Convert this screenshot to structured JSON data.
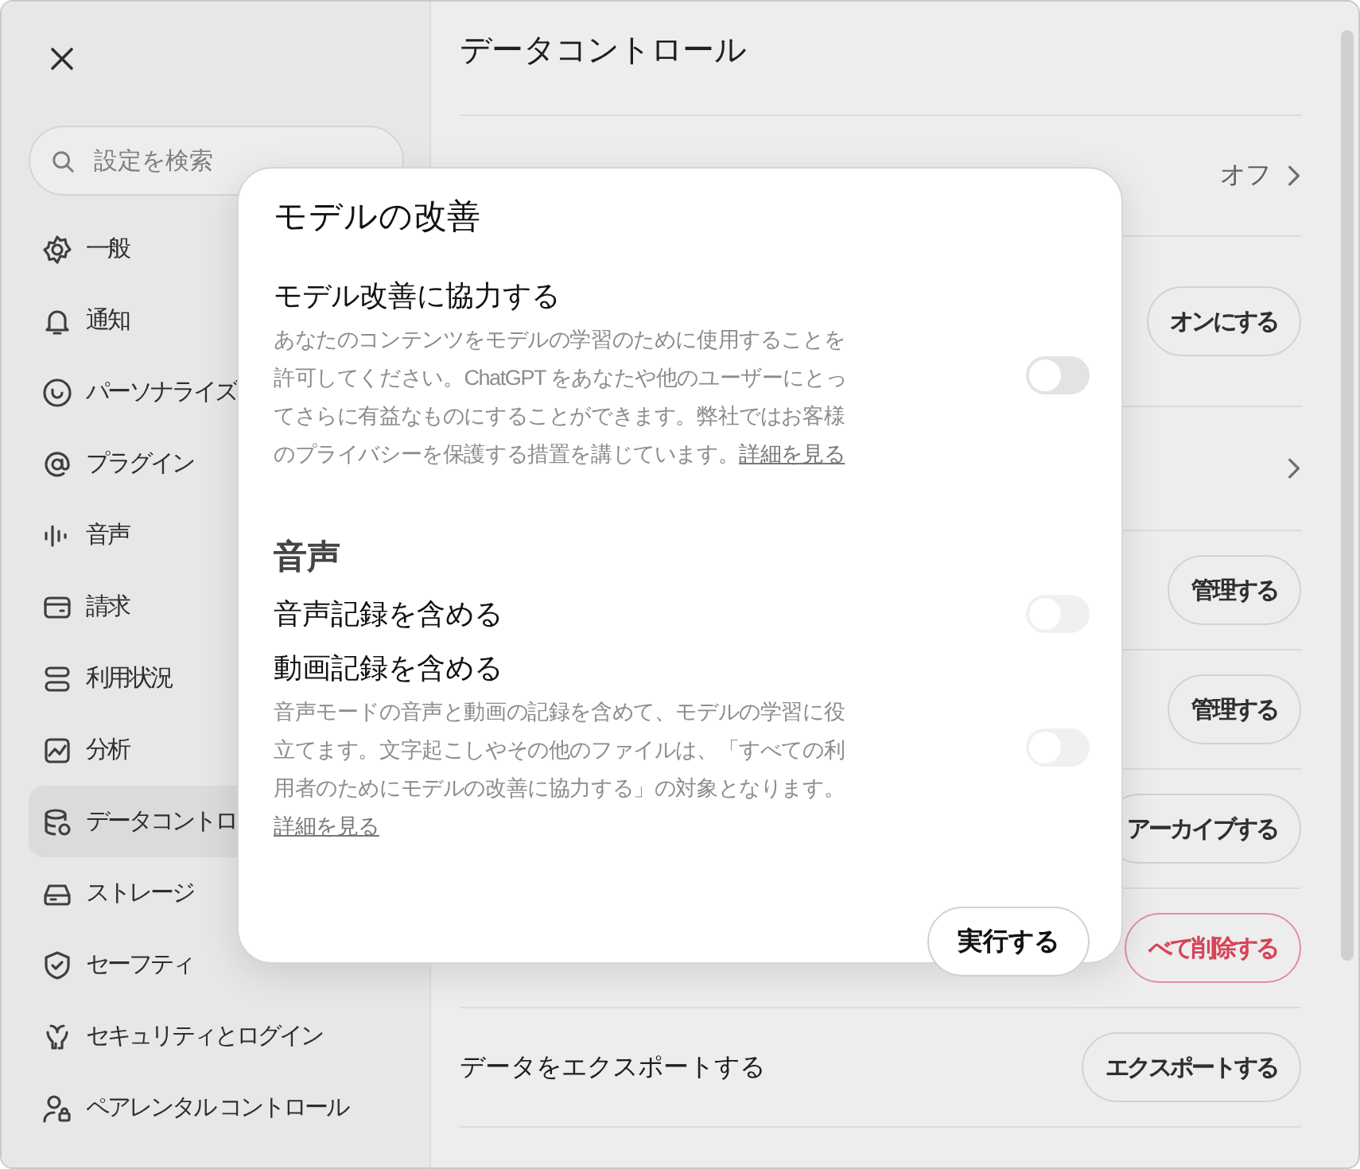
{
  "sidebar": {
    "search": {
      "placeholder": "設定を検索"
    },
    "items": [
      {
        "label": "一般",
        "selected": false
      },
      {
        "label": "通知",
        "selected": false
      },
      {
        "label": "パーソナライズ",
        "selected": false
      },
      {
        "label": "プラグイン",
        "selected": false
      },
      {
        "label": "音声",
        "selected": false
      },
      {
        "label": "請求",
        "selected": false
      },
      {
        "label": "利用状況",
        "selected": false
      },
      {
        "label": "分析",
        "selected": false
      },
      {
        "label": "データコントロ",
        "selected": true
      },
      {
        "label": "ストレージ",
        "selected": false
      },
      {
        "label": "セーフティ",
        "selected": false
      },
      {
        "label": "セキュリティとログイン",
        "selected": false
      },
      {
        "label": "ペアレンタル コントロール",
        "selected": false
      }
    ]
  },
  "main": {
    "title": "データコントロール",
    "rows": [
      {
        "kind": "value",
        "value": "オフ"
      },
      {
        "kind": "button",
        "button": "オンにする"
      },
      {
        "kind": "chevron"
      },
      {
        "kind": "button",
        "button": "管理する"
      },
      {
        "kind": "button",
        "button": "管理する"
      },
      {
        "kind": "button",
        "button": "アーカイブする"
      },
      {
        "kind": "danger",
        "button": "べて削除する"
      },
      {
        "kind": "button",
        "label": "データをエクスポートする",
        "button": "エクスポートする"
      }
    ]
  },
  "dialog": {
    "title": "モデルの改善",
    "sections": [
      {
        "settings": [
          {
            "label": "モデル改善に協力する",
            "description": "あなたのコンテンツをモデルの学習のために使用することを許可してください。ChatGPT をあなたや他のユーザーにとってさらに有益なものにすることができます。弊社ではお客様のプライバシーを保護する措置を講じています。",
            "link": "詳細を見る",
            "on": false,
            "disabled": false
          }
        ]
      },
      {
        "heading": "音声",
        "settings": [
          {
            "label": "音声記録を含める",
            "on": false,
            "disabled": true
          },
          {
            "label": "動画記録を含める",
            "description": "音声モードの音声と動画の記録を含めて、モデルの学習に役立てます。文字起こしやその他のファイルは、「すべての利用者のためにモデルの改善に協力する」の対象となります。",
            "link": "詳細を見る",
            "on": false,
            "disabled": true
          }
        ]
      }
    ],
    "button": "実行する"
  }
}
